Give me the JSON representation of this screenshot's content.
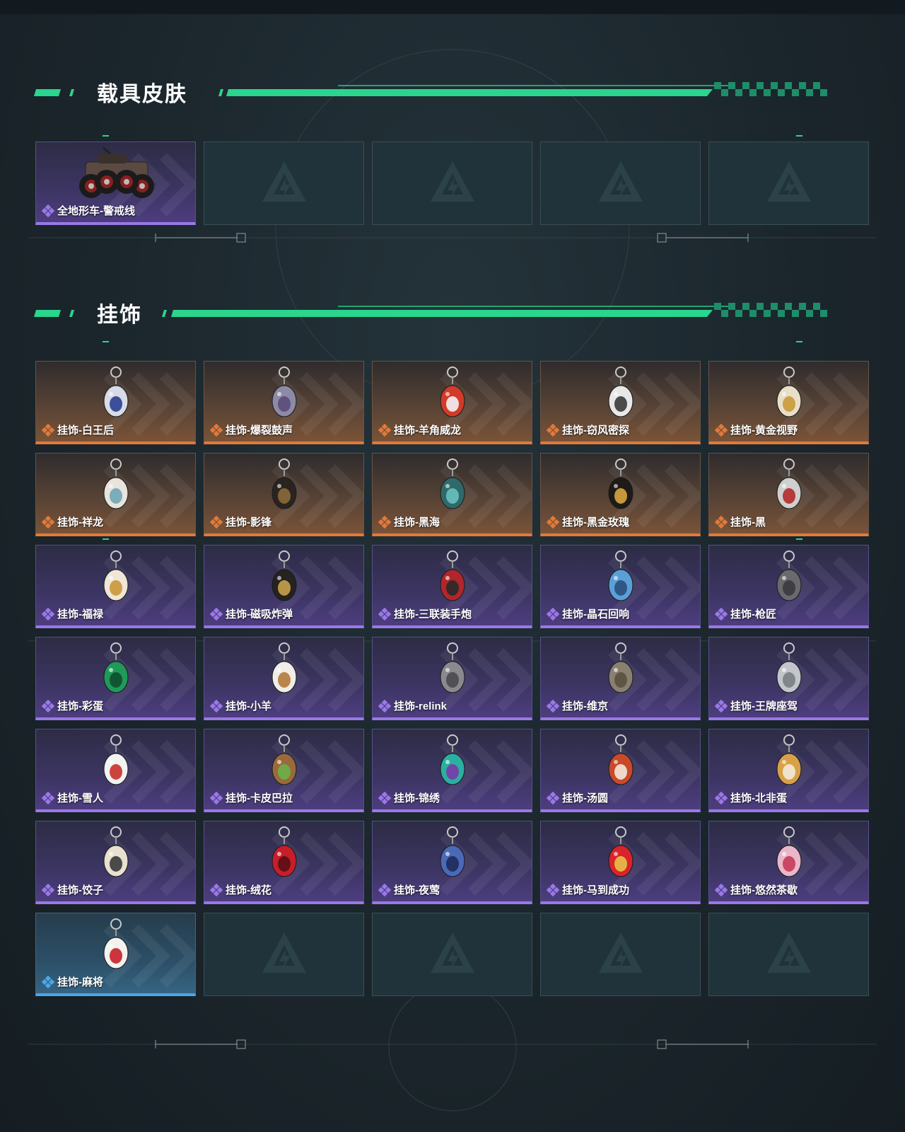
{
  "colors": {
    "accent_green": "#2ad58d",
    "rarity_orange": "#e07a3c",
    "rarity_purple": "#9a78e8",
    "rarity_blue": "#4ca6e8",
    "empty_slot": "#20333a"
  },
  "sections": [
    {
      "title": "载具皮肤",
      "rows": [
        [
          {
            "name": "全地形车-警戒线",
            "rarity": "purple",
            "icon": "atv-vehicle-icon"
          },
          null,
          null,
          null,
          null
        ]
      ]
    },
    {
      "title": "挂饰",
      "rows": [
        [
          {
            "name": "挂饰-白王后",
            "rarity": "orange",
            "icon": "white-queen-charm-icon"
          },
          {
            "name": "挂饰-爆裂鼓声",
            "rarity": "orange",
            "icon": "drum-charm-icon"
          },
          {
            "name": "挂饰-羊角威龙",
            "rarity": "orange",
            "icon": "ram-dragon-charm-icon"
          },
          {
            "name": "挂饰-窃风密探",
            "rarity": "orange",
            "icon": "rabbit-spy-charm-icon"
          },
          {
            "name": "挂饰-黄金视野",
            "rarity": "orange",
            "icon": "golden-vision-charm-icon"
          }
        ],
        [
          {
            "name": "挂饰-祥龙",
            "rarity": "orange",
            "icon": "dragon-charm-icon"
          },
          {
            "name": "挂饰-影锋",
            "rarity": "orange",
            "icon": "shadow-blade-charm-icon"
          },
          {
            "name": "挂饰-黑海",
            "rarity": "orange",
            "icon": "anchor-charm-icon"
          },
          {
            "name": "挂饰-黑金玫瑰",
            "rarity": "orange",
            "icon": "black-gold-rose-charm-icon"
          },
          {
            "name": "挂饰-黑",
            "rarity": "orange",
            "icon": "black-tag-charm-icon"
          }
        ],
        [
          {
            "name": "挂饰-福禄",
            "rarity": "purple",
            "icon": "gourd-charm-icon"
          },
          {
            "name": "挂饰-磁吸炸弹",
            "rarity": "purple",
            "icon": "magnetic-bomb-charm-icon"
          },
          {
            "name": "挂饰-三联装手炮",
            "rarity": "purple",
            "icon": "hand-cannon-charm-icon"
          },
          {
            "name": "挂饰-晶石回响",
            "rarity": "purple",
            "icon": "crystal-charm-icon"
          },
          {
            "name": "挂饰-枪匠",
            "rarity": "purple",
            "icon": "gunsmith-charm-icon"
          }
        ],
        [
          {
            "name": "挂饰-彩蛋",
            "rarity": "purple",
            "icon": "easter-egg-charm-icon"
          },
          {
            "name": "挂饰-小羊",
            "rarity": "purple",
            "icon": "lamb-charm-icon"
          },
          {
            "name": "挂饰-relink",
            "rarity": "purple",
            "icon": "relink-charm-icon"
          },
          {
            "name": "挂饰-维京",
            "rarity": "purple",
            "icon": "viking-axe-charm-icon"
          },
          {
            "name": "挂饰-王牌座驾",
            "rarity": "purple",
            "icon": "fighter-jet-charm-icon"
          }
        ],
        [
          {
            "name": "挂饰-雪人",
            "rarity": "purple",
            "icon": "snowman-charm-icon"
          },
          {
            "name": "挂饰-卡皮巴拉",
            "rarity": "purple",
            "icon": "capybara-charm-icon"
          },
          {
            "name": "挂饰-锦绣",
            "rarity": "purple",
            "icon": "butterfly-charm-icon"
          },
          {
            "name": "挂饰-汤圆",
            "rarity": "purple",
            "icon": "tangyuan-charm-icon"
          },
          {
            "name": "挂饰-北非蛋",
            "rarity": "purple",
            "icon": "shakshuka-charm-icon"
          }
        ],
        [
          {
            "name": "挂饰-饺子",
            "rarity": "purple",
            "icon": "dumpling-charm-icon"
          },
          {
            "name": "挂饰-绒花",
            "rarity": "purple",
            "icon": "velvet-flower-charm-icon"
          },
          {
            "name": "挂饰-夜莺",
            "rarity": "purple",
            "icon": "feather-charm-icon"
          },
          {
            "name": "挂饰-马到成功",
            "rarity": "purple",
            "icon": "red-horse-charm-icon"
          },
          {
            "name": "挂饰-悠然茶歇",
            "rarity": "purple",
            "icon": "cupcake-charm-icon"
          }
        ],
        [
          {
            "name": "挂饰-麻将",
            "rarity": "blue",
            "icon": "mahjong-tile-charm-icon"
          },
          null,
          null,
          null,
          null
        ]
      ]
    }
  ]
}
